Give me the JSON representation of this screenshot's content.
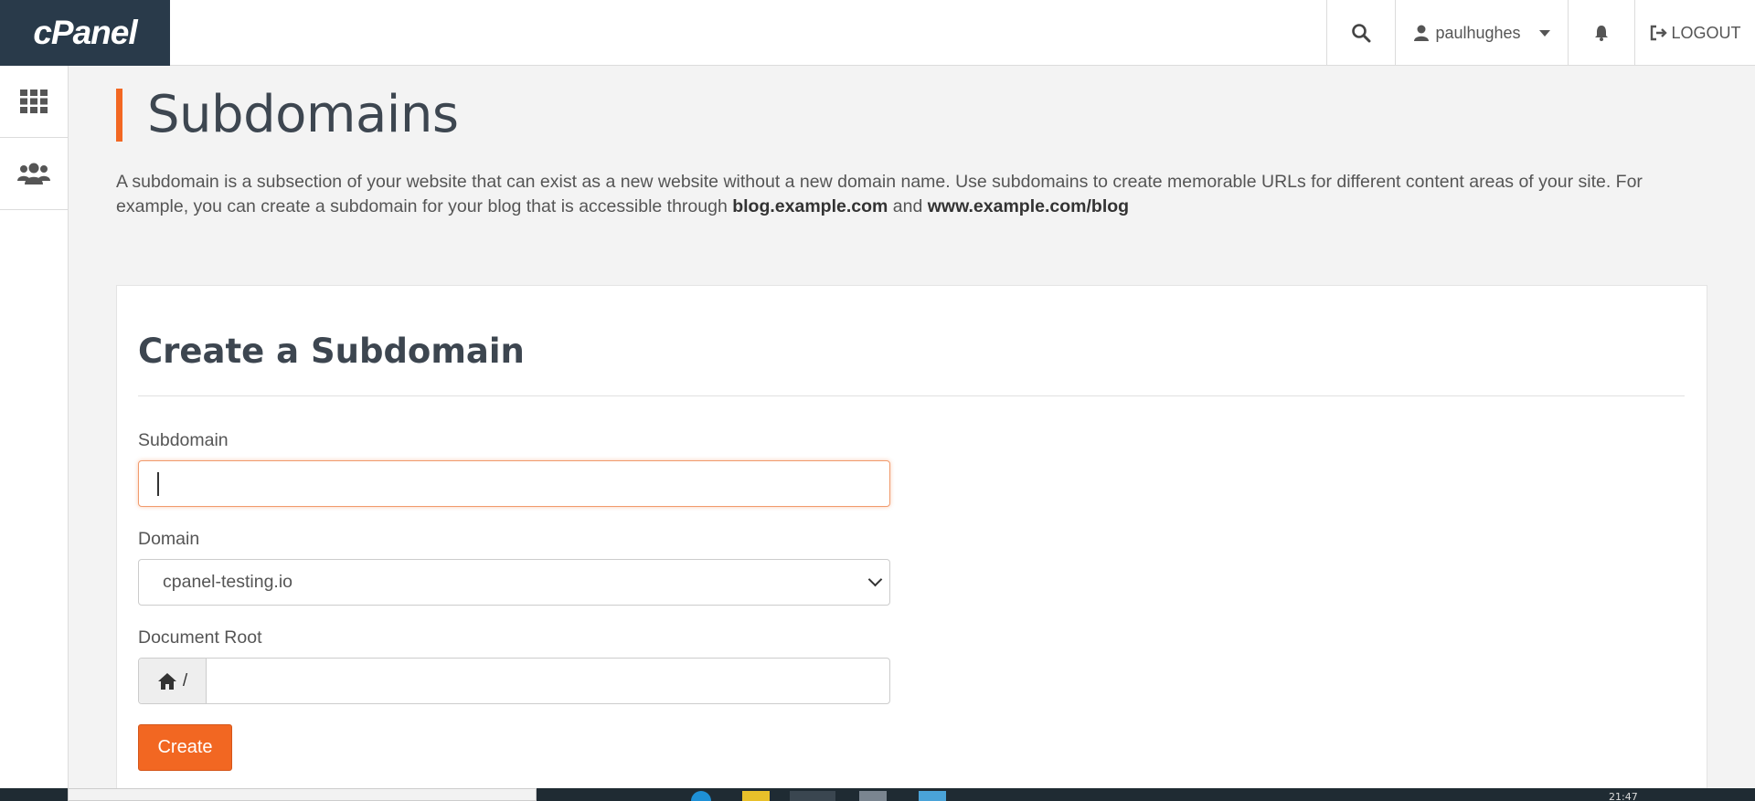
{
  "header": {
    "logo_text": "cPanel",
    "username": "paulhughes",
    "logout_label": "LOGOUT"
  },
  "page": {
    "title": "Subdomains",
    "description_part1": "A subdomain is a subsection of your website that can exist as a new website without a new domain name. Use subdomains to create memorable URLs for different content areas of your site. For example, you can create a subdomain for your blog that is accessible through ",
    "description_bold1": "blog.example.com",
    "description_and": " and ",
    "description_bold2": "www.example.com/blog"
  },
  "form": {
    "title": "Create a Subdomain",
    "subdomain_label": "Subdomain",
    "subdomain_value": "",
    "domain_label": "Domain",
    "domain_selected": "cpanel-testing.io",
    "docroot_label": "Document Root",
    "docroot_prefix": "/",
    "docroot_value": "",
    "create_label": "Create"
  },
  "taskbar": {
    "time": "21:47"
  },
  "colors": {
    "accent": "#f26722",
    "logo_bg": "#293a4a"
  }
}
